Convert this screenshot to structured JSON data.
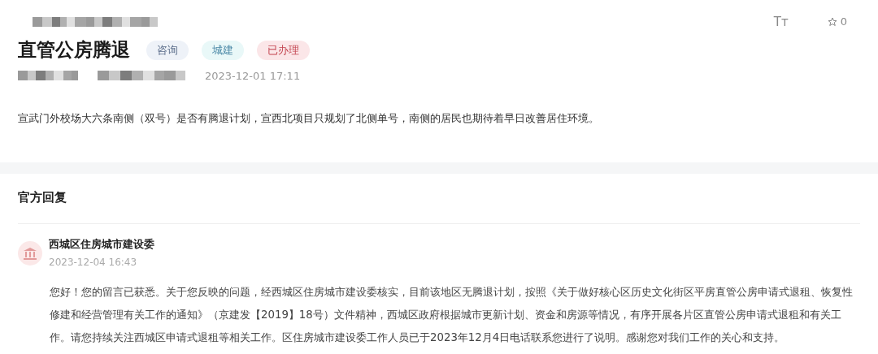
{
  "header": {
    "font_size_label": "Tт",
    "favorites_count": "0"
  },
  "question": {
    "title": "直管公房腾退",
    "tags": [
      {
        "label": "咨询",
        "kind": "type"
      },
      {
        "label": "城建",
        "kind": "category"
      },
      {
        "label": "已办理",
        "kind": "status"
      }
    ],
    "date": "2023-12-01 17:11",
    "body": "宣武门外校场大六条南侧（双号）是否有腾退计划，宣西北项目只规划了北侧单号，南侧的居民也期待着早日改善居住环境。"
  },
  "reply": {
    "heading": "官方回复",
    "department": "西城区住房城市建设委",
    "date": "2023-12-04 16:43",
    "body": "您好！您的留言已获悉。关于您反映的问题，经西城区住房城市建设委核实，目前该地区无腾退计划，按照《关于做好核心区历史文化街区平房直管公房申请式退租、恢复性修建和经营管理有关工作的通知》（京建发【2019】18号）文件精神，西城区政府根据城市更新计划、资金和房源等情况，有序开展各片区直管公房申请式退租和有关工作。请您持续关注西城区申请式退租等相关工作。区住房城市建设委工作人员已于2023年12月4日电话联系您进行了说明。感谢您对我们工作的关心和支持。"
  }
}
